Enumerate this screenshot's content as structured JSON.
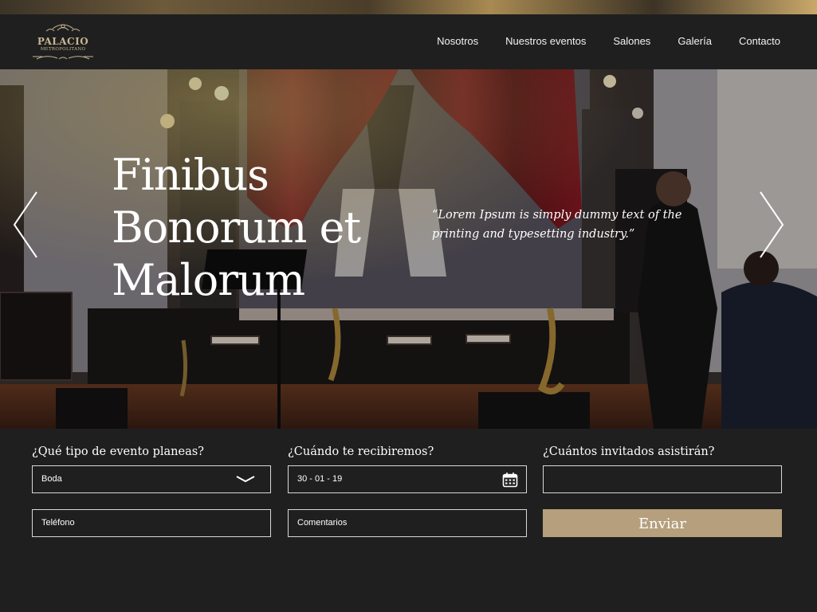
{
  "brand": {
    "line1": "PALACIO",
    "line2": "METROPOLITANO"
  },
  "nav": {
    "items": [
      {
        "label": "Nosotros"
      },
      {
        "label": "Nuestros eventos"
      },
      {
        "label": "Salones"
      },
      {
        "label": "Galería"
      },
      {
        "label": "Contacto"
      }
    ]
  },
  "hero": {
    "title": "Finibus Bonorum et Malorum",
    "quote": "“Lorem Ipsum is simply dummy text of the printing and typesetting industry.”",
    "prev_icon": "chevron-left-icon",
    "next_icon": "chevron-right-icon"
  },
  "form": {
    "event_type_label": "¿Qué tipo de evento planeas?",
    "event_type_value": "Boda",
    "date_label": "¿Cuándo te recibiremos?",
    "date_value": "30 - 01 - 19",
    "guests_label": "¿Cuántos invitados asistirán?",
    "guests_value": "",
    "phone_placeholder": "Teléfono",
    "comments_placeholder": "Comentarios",
    "submit_label": "Enviar"
  },
  "colors": {
    "background": "#1f1f1f",
    "accent": "#b59f7c",
    "text": "#ffffff"
  }
}
